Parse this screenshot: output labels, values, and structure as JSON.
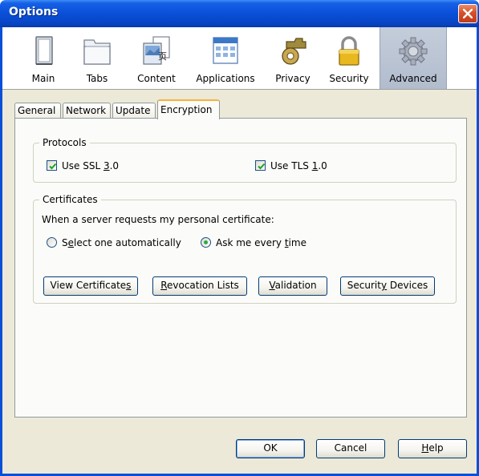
{
  "window": {
    "title": "Options"
  },
  "panes": [
    {
      "label": "Main",
      "icon": "main-icon"
    },
    {
      "label": "Tabs",
      "icon": "tabs-icon"
    },
    {
      "label": "Content",
      "icon": "content-icon"
    },
    {
      "label": "Applications",
      "icon": "applications-icon"
    },
    {
      "label": "Privacy",
      "icon": "privacy-icon"
    },
    {
      "label": "Security",
      "icon": "security-icon"
    },
    {
      "label": "Advanced",
      "icon": "advanced-icon",
      "selected": true
    }
  ],
  "tabs": [
    {
      "label": "General"
    },
    {
      "label": "Network"
    },
    {
      "label": "Update"
    },
    {
      "label": "Encryption",
      "active": true
    }
  ],
  "protocols": {
    "title": "Protocols",
    "ssl": {
      "pre": "Use SSL ",
      "key": "3",
      "post": ".0",
      "checked": true
    },
    "tls": {
      "pre": "Use TLS ",
      "key": "1",
      "post": ".0",
      "checked": true
    }
  },
  "certificates": {
    "title": "Certificates",
    "prompt": "When a server requests my personal certificate:",
    "auto": {
      "pre": "S",
      "key": "e",
      "post": "lect one automatically",
      "selected": false
    },
    "ask": {
      "pre": "Ask me every ",
      "key": "t",
      "post": "ime",
      "selected": true
    },
    "buttons": {
      "view": {
        "pre": "View Certificate",
        "key": "s",
        "post": ""
      },
      "revocation": {
        "pre": "",
        "key": "R",
        "post": "evocation Lists"
      },
      "validation": {
        "pre": "",
        "key": "V",
        "post": "alidation"
      },
      "devices": {
        "pre": "Securit",
        "key": "y",
        "post": " Devices"
      }
    }
  },
  "footer": {
    "ok": "OK",
    "cancel": "Cancel",
    "help": {
      "pre": "",
      "key": "H",
      "post": "elp"
    }
  },
  "colors": {
    "titlebar": "#0a4fd8",
    "dialog_bg": "#ece9d8",
    "selected_pane": "#b8c2d2",
    "check_mark": "#21a121",
    "radio_dot": "#2dab3b",
    "active_tab_highlight": "#f5b33a"
  }
}
